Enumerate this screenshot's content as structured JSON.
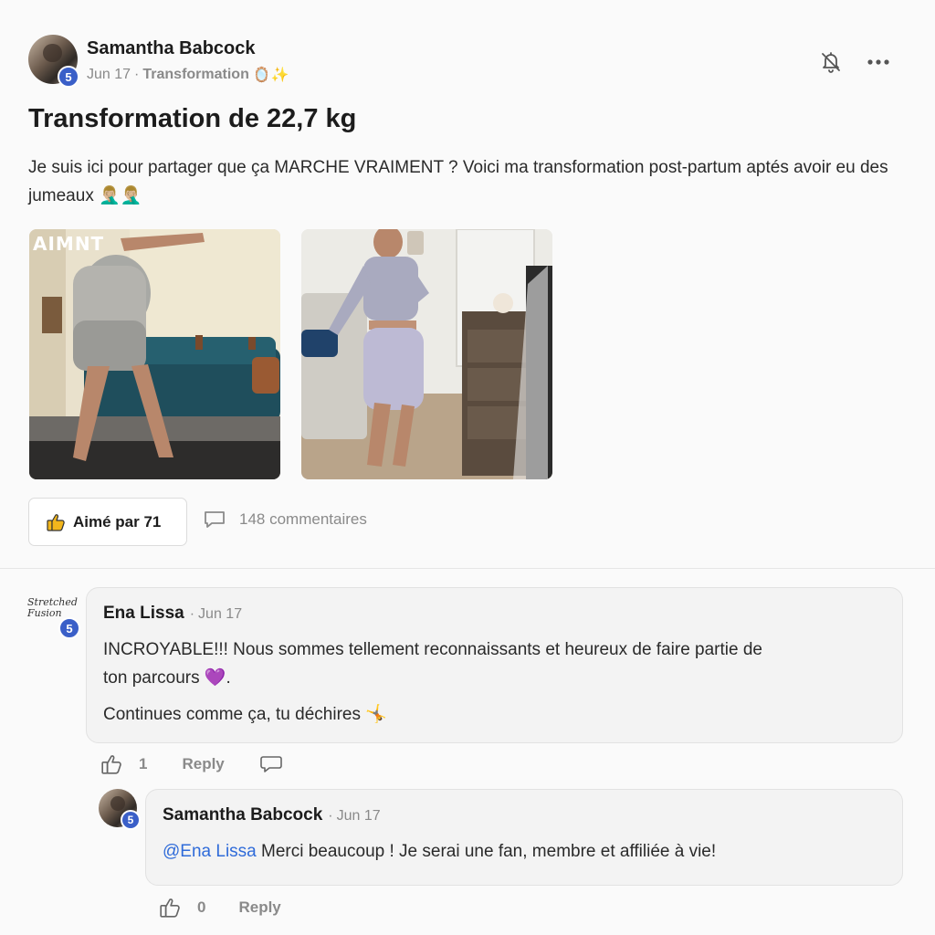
{
  "post": {
    "author": {
      "name": "Samantha Babcock",
      "level": "5"
    },
    "date": "Jun 17",
    "category": "Transformation",
    "category_emoji": "🪞✨",
    "title": "Transformation de 22,7 kg",
    "body": "Je suis ici pour partager que ça MARCHE VRAIMENT ? Voici ma transformation post-partum aptés avoir eu des jumeaux 🤦🏼‍♂️🤦🏼‍♂️",
    "images": [
      {
        "name": "before-photo",
        "overlay_text": "AIMNT"
      },
      {
        "name": "after-photo"
      }
    ],
    "likes_label": "Aimé par 71",
    "comments_label": "148 commentaires",
    "icons": {
      "notify": "bell-off-icon",
      "more": "more-icon",
      "like": "thumbs-up-icon",
      "comments": "comment-bubble-icon"
    }
  },
  "comments": [
    {
      "author": "Ena Lissa",
      "avatar_text": "Stretched Fusion",
      "level": "5",
      "date": "Jun 17",
      "lines": [
        "INCROYABLE!!! Nous sommes tellement reconnaissants et heureux de faire partie de",
        "ton parcours 💜.",
        "Continues comme ça, tu déchires 🤸"
      ],
      "likes": "1",
      "reply_label": "Reply",
      "replies": [
        {
          "author": "Samantha Babcock",
          "level": "5",
          "date": "Jun 17",
          "mention": "@Ena Lissa",
          "text": " Merci beaucoup ! Je serai une fan, membre et affiliée à vie!",
          "likes": "0",
          "reply_label": "Reply"
        }
      ]
    }
  ],
  "colors": {
    "accent_blue": "#3a5fc8",
    "mention": "#2f6bd9",
    "muted": "#8a8a8a",
    "like_yellow": "#f2b61c"
  }
}
